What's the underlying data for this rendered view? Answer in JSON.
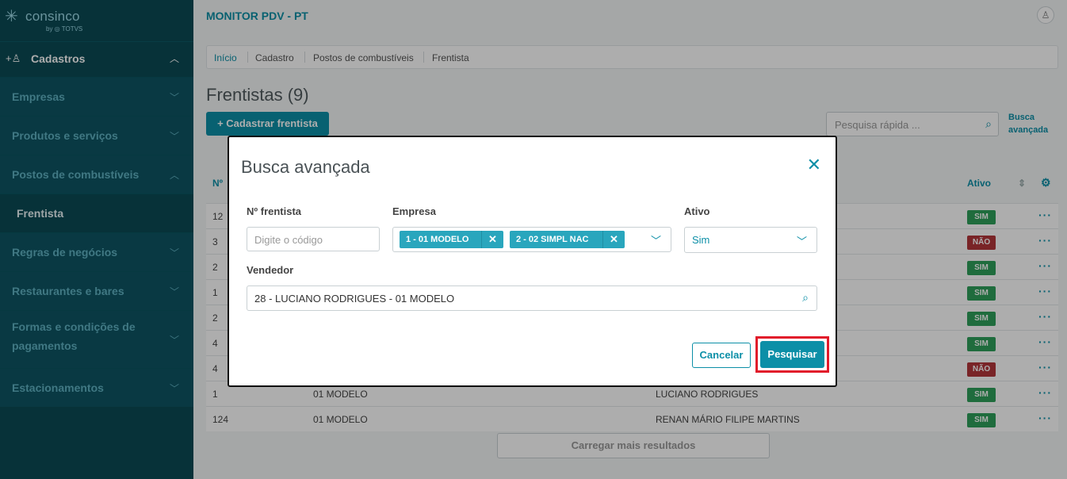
{
  "brand": {
    "name": "consinco",
    "by": "by ◎ TOTVS"
  },
  "sidebar": {
    "section_label": "Cadastros",
    "items": [
      {
        "label": "Empresas"
      },
      {
        "label": "Produtos e serviços"
      },
      {
        "label": "Postos de combustíveis"
      },
      {
        "label": "Frentista"
      },
      {
        "label": "Regras de negócios"
      },
      {
        "label": "Restaurantes e bares"
      },
      {
        "label": "Formas e condições de pagamentos"
      },
      {
        "label": "Estacionamentos"
      }
    ]
  },
  "header": {
    "title": "MONITOR PDV - PT"
  },
  "breadcrumb": [
    "Início",
    "Cadastro",
    "Postos de combustíveis",
    "Frentista"
  ],
  "page": {
    "title": "Frentistas (9)",
    "add_button": "+ Cadastrar frentista",
    "quick_search_placeholder": "Pesquisa rápida ...",
    "advanced_link": "Busca avançada",
    "load_more": "Carregar mais resultados"
  },
  "table": {
    "headers": {
      "number": "Nº",
      "active": "Ativo"
    },
    "rows": [
      {
        "num": "12",
        "company": "",
        "seller": "",
        "active": "SIM"
      },
      {
        "num": "3",
        "company": "",
        "seller": "",
        "active": "NÃO"
      },
      {
        "num": "2",
        "company": "",
        "seller": "",
        "active": "SIM"
      },
      {
        "num": "1",
        "company": "",
        "seller": "",
        "active": "SIM"
      },
      {
        "num": "2",
        "company": "",
        "seller": "",
        "active": "SIM"
      },
      {
        "num": "4",
        "company": "",
        "seller": "",
        "active": "SIM"
      },
      {
        "num": "4",
        "company": "",
        "seller": "",
        "active": "NÃO"
      },
      {
        "num": "1",
        "company": "01 MODELO",
        "seller": "LUCIANO RODRIGUES",
        "active": "SIM"
      },
      {
        "num": "124",
        "company": "01 MODELO",
        "seller": "RENAN MÁRIO FILIPE MARTINS",
        "active": "SIM"
      }
    ]
  },
  "modal": {
    "title": "Busca avançada",
    "fields": {
      "number_label": "Nº frentista",
      "number_placeholder": "Digite o código",
      "company_label": "Empresa",
      "company_chips": [
        "1 - 01 MODELO",
        "2 - 02 SIMPL NAC"
      ],
      "active_label": "Ativo",
      "active_value": "Sim",
      "seller_label": "Vendedor",
      "seller_value": "28 - LUCIANO RODRIGUES - 01 MODELO"
    },
    "cancel_label": "Cancelar",
    "search_label": "Pesquisar"
  }
}
